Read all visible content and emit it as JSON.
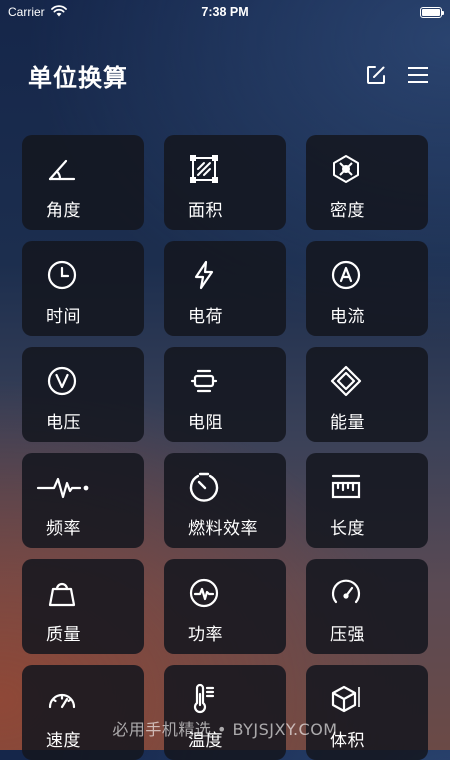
{
  "status_bar": {
    "carrier": "Carrier",
    "time": "7:38 PM"
  },
  "header": {
    "title": "单位换算",
    "edit_icon": "edit-icon",
    "menu_icon": "menu-icon"
  },
  "tiles": [
    {
      "label": "角度",
      "icon": "angle-icon"
    },
    {
      "label": "面积",
      "icon": "area-icon"
    },
    {
      "label": "密度",
      "icon": "density-icon"
    },
    {
      "label": "时间",
      "icon": "clock-icon"
    },
    {
      "label": "电荷",
      "icon": "lightning-icon"
    },
    {
      "label": "电流",
      "icon": "ampere-icon"
    },
    {
      "label": "电压",
      "icon": "voltage-icon"
    },
    {
      "label": "电阻",
      "icon": "resistor-icon"
    },
    {
      "label": "能量",
      "icon": "energy-icon"
    },
    {
      "label": "频率",
      "icon": "pulse-icon"
    },
    {
      "label": "燃料效率",
      "icon": "fuel-efficiency-icon"
    },
    {
      "label": "长度",
      "icon": "ruler-icon"
    },
    {
      "label": "质量",
      "icon": "weight-icon"
    },
    {
      "label": "功率",
      "icon": "power-icon"
    },
    {
      "label": "压强",
      "icon": "gauge-icon"
    },
    {
      "label": "速度",
      "icon": "speedometer-icon"
    },
    {
      "label": "温度",
      "icon": "thermometer-icon"
    },
    {
      "label": "体积",
      "icon": "cube-icon"
    }
  ],
  "watermark": "必用手机精选 • BYJSJXY.COM"
}
